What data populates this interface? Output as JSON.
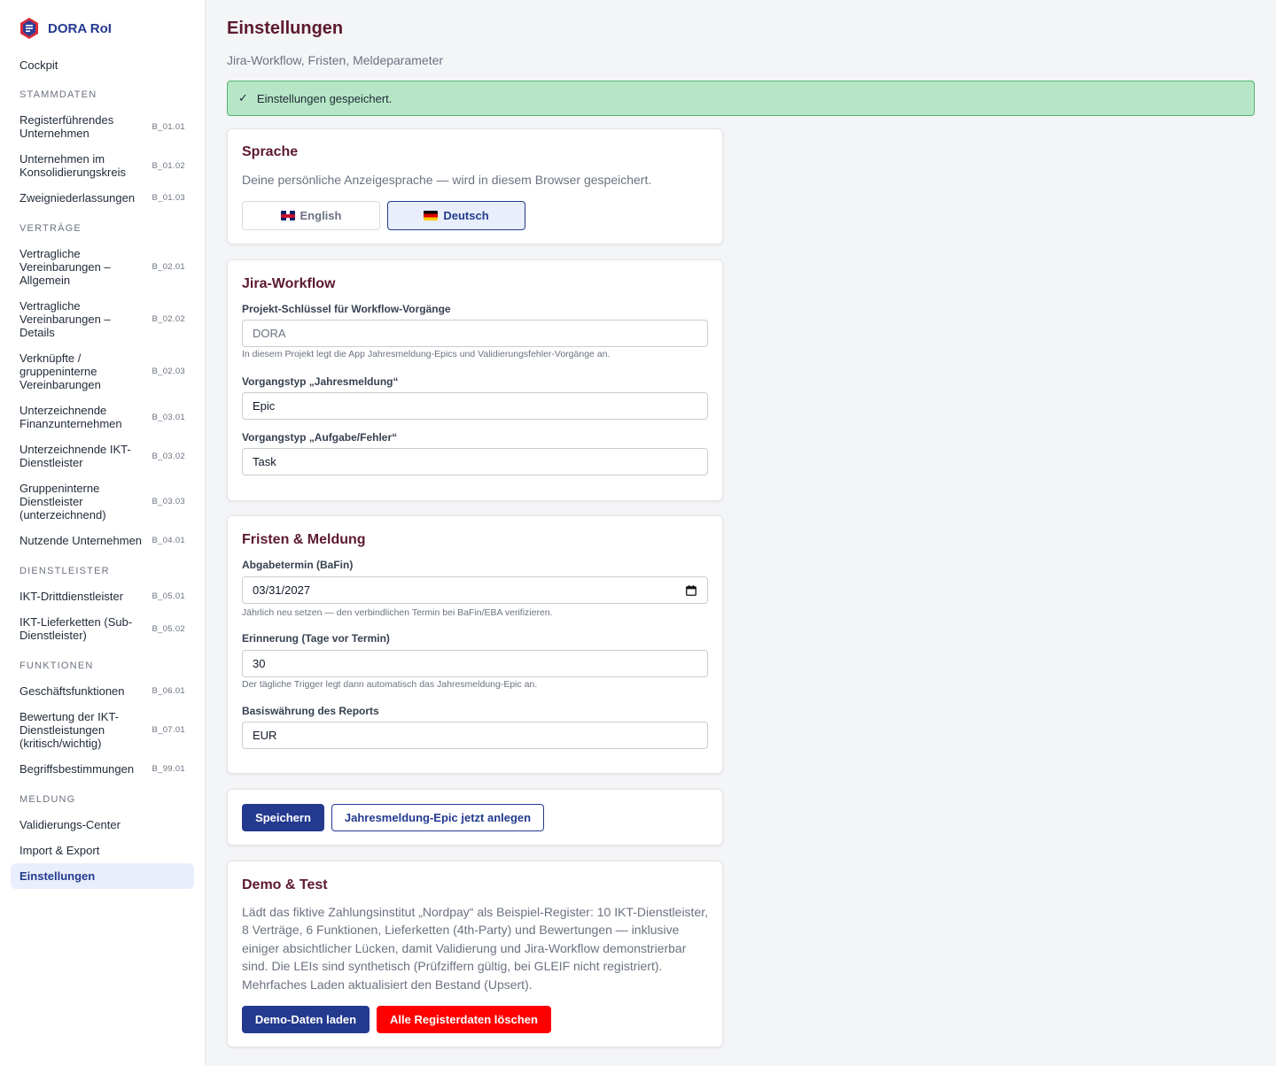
{
  "app": {
    "name": "DORA RoI",
    "colors": {
      "primary": "#233a8f",
      "heading": "#5c1a2e",
      "success_bg": "#b6e6c6",
      "danger": "#ff0000"
    }
  },
  "sidebar": {
    "cockpit": "Cockpit",
    "sections": {
      "stammdaten": "STAMMDATEN",
      "vertraege": "VERTRÄGE",
      "dienstleister": "DIENSTLEISTER",
      "funktionen": "FUNKTIONEN",
      "meldung": "MELDUNG"
    },
    "items": [
      {
        "label": "Registerführendes Unternehmen",
        "code": "B_01.01"
      },
      {
        "label": "Unternehmen im Konsolidierungskreis",
        "code": "B_01.02"
      },
      {
        "label": "Zweigniederlassungen",
        "code": "B_01.03"
      },
      {
        "label": "Vertragliche Vereinbarungen – Allgemein",
        "code": "B_02.01"
      },
      {
        "label": "Vertragliche Vereinbarungen – Details",
        "code": "B_02.02"
      },
      {
        "label": "Verknüpfte / gruppeninterne Vereinbarungen",
        "code": "B_02.03"
      },
      {
        "label": "Unterzeichnende Finanzunternehmen",
        "code": "B_03.01"
      },
      {
        "label": "Unterzeichnende IKT-Dienstleister",
        "code": "B_03.02"
      },
      {
        "label": "Gruppeninterne Dienstleister (unterzeichnend)",
        "code": "B_03.03"
      },
      {
        "label": "Nutzende Unternehmen",
        "code": "B_04.01"
      },
      {
        "label": "IKT-Drittdienstleister",
        "code": "B_05.01"
      },
      {
        "label": "IKT-Lieferketten (Sub-Dienstleister)",
        "code": "B_05.02"
      },
      {
        "label": "Geschäftsfunktionen",
        "code": "B_06.01"
      },
      {
        "label": "Bewertung der IKT-Dienstleistungen (kritisch/wichtig)",
        "code": "B_07.01"
      },
      {
        "label": "Begriffsbestimmungen",
        "code": "B_99.01"
      }
    ],
    "meldung_items": [
      "Validierungs-Center",
      "Import & Export",
      "Einstellungen"
    ]
  },
  "main": {
    "title": "Einstellungen",
    "subtitle": "Jira-Workflow, Fristen, Meldeparameter",
    "alert": {
      "icon": "✓",
      "text": "Einstellungen gespeichert."
    }
  },
  "language": {
    "title": "Sprache",
    "description": "Deine persönliche Anzeigesprache — wird in diesem Browser gespeichert.",
    "options": [
      {
        "label": "English",
        "flag": "uk-flag-icon",
        "selected": false
      },
      {
        "label": "Deutsch",
        "flag": "de-flag-icon",
        "selected": true
      }
    ]
  },
  "jira": {
    "title": "Jira-Workflow",
    "project_key": {
      "label": "Projekt-Schlüssel für Workflow-Vorgänge",
      "placeholder": "DORA",
      "hint": "In diesem Projekt legt die App Jahresmeldung-Epics und Validierungsfehler-Vorgänge an."
    },
    "issue_type_annual": {
      "label": "Vorgangstyp „Jahresmeldung“",
      "value": "Epic"
    },
    "issue_type_task": {
      "label": "Vorgangstyp „Aufgabe/Fehler“",
      "value": "Task"
    }
  },
  "deadlines": {
    "title": "Fristen & Meldung",
    "deadline": {
      "label": "Abgabetermin (BaFin)",
      "value": "03/31/2027",
      "hint": "Jährlich neu setzen — den verbindlichen Termin bei BaFin/EBA verifizieren."
    },
    "reminder": {
      "label": "Erinnerung (Tage vor Termin)",
      "value": "30",
      "hint": "Der tägliche Trigger legt dann automatisch das Jahresmeldung-Epic an."
    },
    "currency": {
      "label": "Basiswährung des Reports",
      "value": "EUR"
    }
  },
  "actions": {
    "save": "Speichern",
    "create_epic": "Jahresmeldung-Epic jetzt anlegen"
  },
  "demo": {
    "title": "Demo & Test",
    "description": "Lädt das fiktive Zahlungsinstitut „Nordpay“ als Beispiel-Register: 10 IKT-Dienstleister, 8 Verträge, 6 Funktionen, Lieferketten (4th-Party) und Bewertungen — inklusive einiger absichtlicher Lücken, damit Validierung und Jira-Workflow demonstrierbar sind. Die LEIs sind synthetisch (Prüfziffern gültig, bei GLEIF nicht registriert). Mehrfaches Laden aktualisiert den Bestand (Upsert).",
    "load": "Demo-Daten laden",
    "delete": "Alle Registerdaten löschen"
  }
}
